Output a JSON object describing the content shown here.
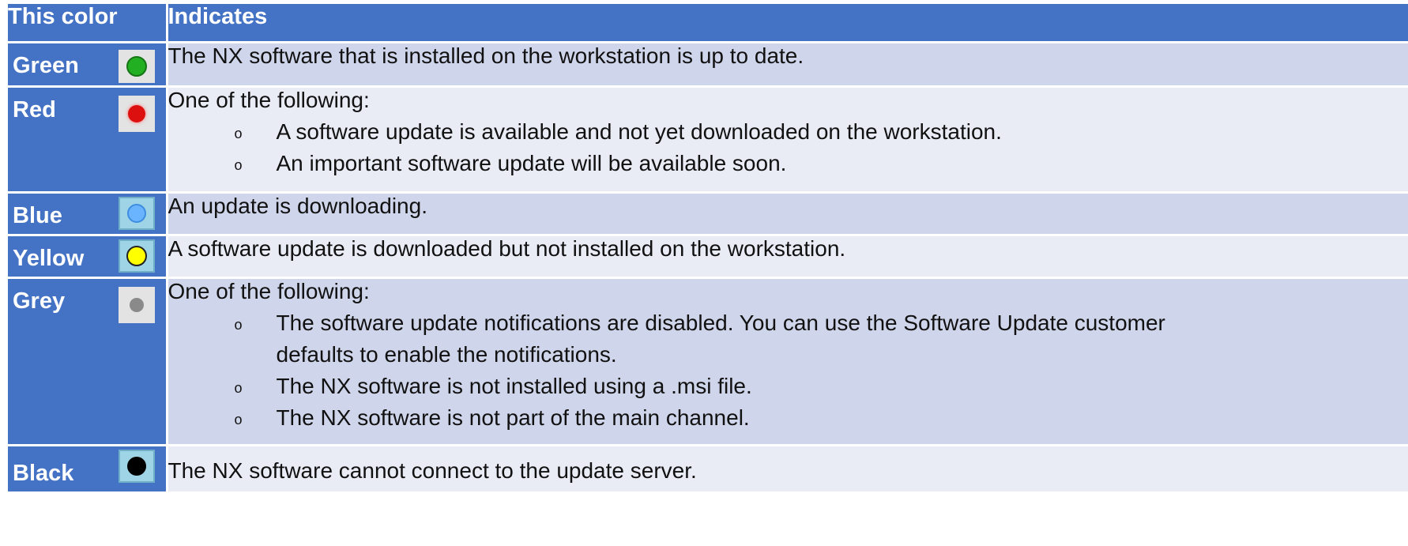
{
  "table": {
    "header": {
      "color_col": "This color",
      "desc_col": "Indicates"
    },
    "rows": [
      {
        "name": "Green",
        "dot_color": "#22b022",
        "description": "The NX software that is installed on the workstation is up to date."
      },
      {
        "name": "Red",
        "dot_color": "#dd1010",
        "description": "One of the following:",
        "bullets": [
          "A software update is available and not yet downloaded on the workstation.",
          "An important software update will be available soon."
        ]
      },
      {
        "name": "Blue",
        "dot_color": "#6ab4ff",
        "description": "An update is downloading."
      },
      {
        "name": "Yellow",
        "dot_color": "#ffff00",
        "description": "A software update is downloaded but not installed on the workstation."
      },
      {
        "name": "Grey",
        "dot_color": "#8a8a8a",
        "description": "One of the following:",
        "bullets": [
          "The software update notifications are disabled. You can use the Software Update customer",
          "defaults to enable the notifications.",
          "The NX software is not installed using a .msi file.",
          "The NX software is not part of the main channel."
        ]
      },
      {
        "name": "Black",
        "dot_color": "#000000",
        "description": "The NX software cannot connect to the update server."
      }
    ],
    "bullet_glyph": "o"
  }
}
